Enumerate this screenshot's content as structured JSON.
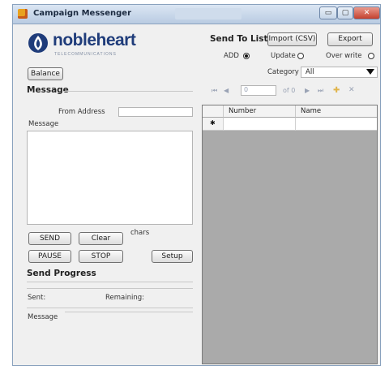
{
  "window": {
    "title": "Campaign Messenger",
    "minimize_glyph": "▭",
    "maximize_glyph": "▢",
    "close_glyph": "✕"
  },
  "logo": {
    "name": "nobleheart",
    "tagline": "TELECOMMUNICATIONS"
  },
  "buttons": {
    "balance": "Balance",
    "import": "Import (CSV)",
    "export": "Export",
    "send": "SEND",
    "clear": "Clear",
    "pause": "PAUSE",
    "stop": "STOP",
    "setup": "Setup"
  },
  "message_section": {
    "title": "Message",
    "from_label": "From Address",
    "message_label": "Message",
    "chars_label": "chars"
  },
  "send_list": {
    "title": "Send To List",
    "options": [
      {
        "label": "ADD",
        "selected": true
      },
      {
        "label": "Update",
        "selected": false
      },
      {
        "label": "Over write",
        "selected": false
      }
    ],
    "category_label": "Category",
    "category_value": "All"
  },
  "navigator": {
    "first": "⏮",
    "prev": "◀",
    "position": "0",
    "of_count": "of 0",
    "next": "▶",
    "last": "⏭",
    "add": "✚",
    "delete": "✕"
  },
  "grid": {
    "columns": [
      "Number",
      "Name"
    ],
    "new_row_marker": "✱"
  },
  "progress": {
    "title": "Send Progress",
    "sent_label": "Sent:",
    "remaining_label": "Remaining:",
    "message_label": "Message"
  },
  "colors": {
    "accent": "#1f3c7a",
    "grid_background": "#aaaaaa"
  }
}
